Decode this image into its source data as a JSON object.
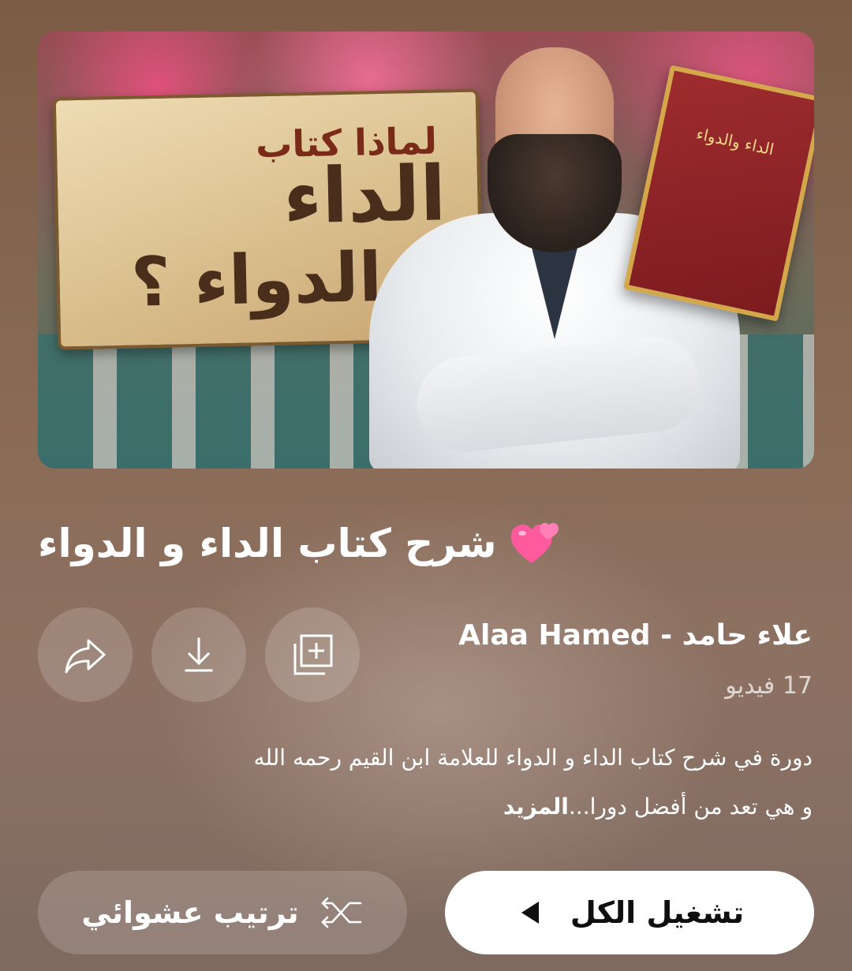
{
  "thumbnail": {
    "sign_line1": "لماذا كتاب",
    "sign_line2": "الداء",
    "sign_line3": "و الدواء ؟",
    "book_title": "الداء والدواء"
  },
  "playlist": {
    "title": "شرح كتاب الداء و الدواء",
    "title_emoji_icon": "two-hearts-icon",
    "channel": "علاء حامد - Alaa Hamed",
    "video_count": "17 فيديو",
    "description_line1": "دورة في شرح كتاب الداء و الدواء للعلامة ابن القيم رحمه الله",
    "description_line2": "و هي تعد من أفضل دورا...",
    "more_label": "المزيد"
  },
  "actions": {
    "save_icon": "add-to-library-icon",
    "download_icon": "download-icon",
    "share_icon": "share-icon"
  },
  "buttons": {
    "play_all_label": "تشغيل الكل",
    "shuffle_label": "ترتيب عشوائي"
  },
  "colors": {
    "background": "#8a6b56",
    "play_button_bg": "#ffffff",
    "play_button_text": "#0f0f0f"
  }
}
